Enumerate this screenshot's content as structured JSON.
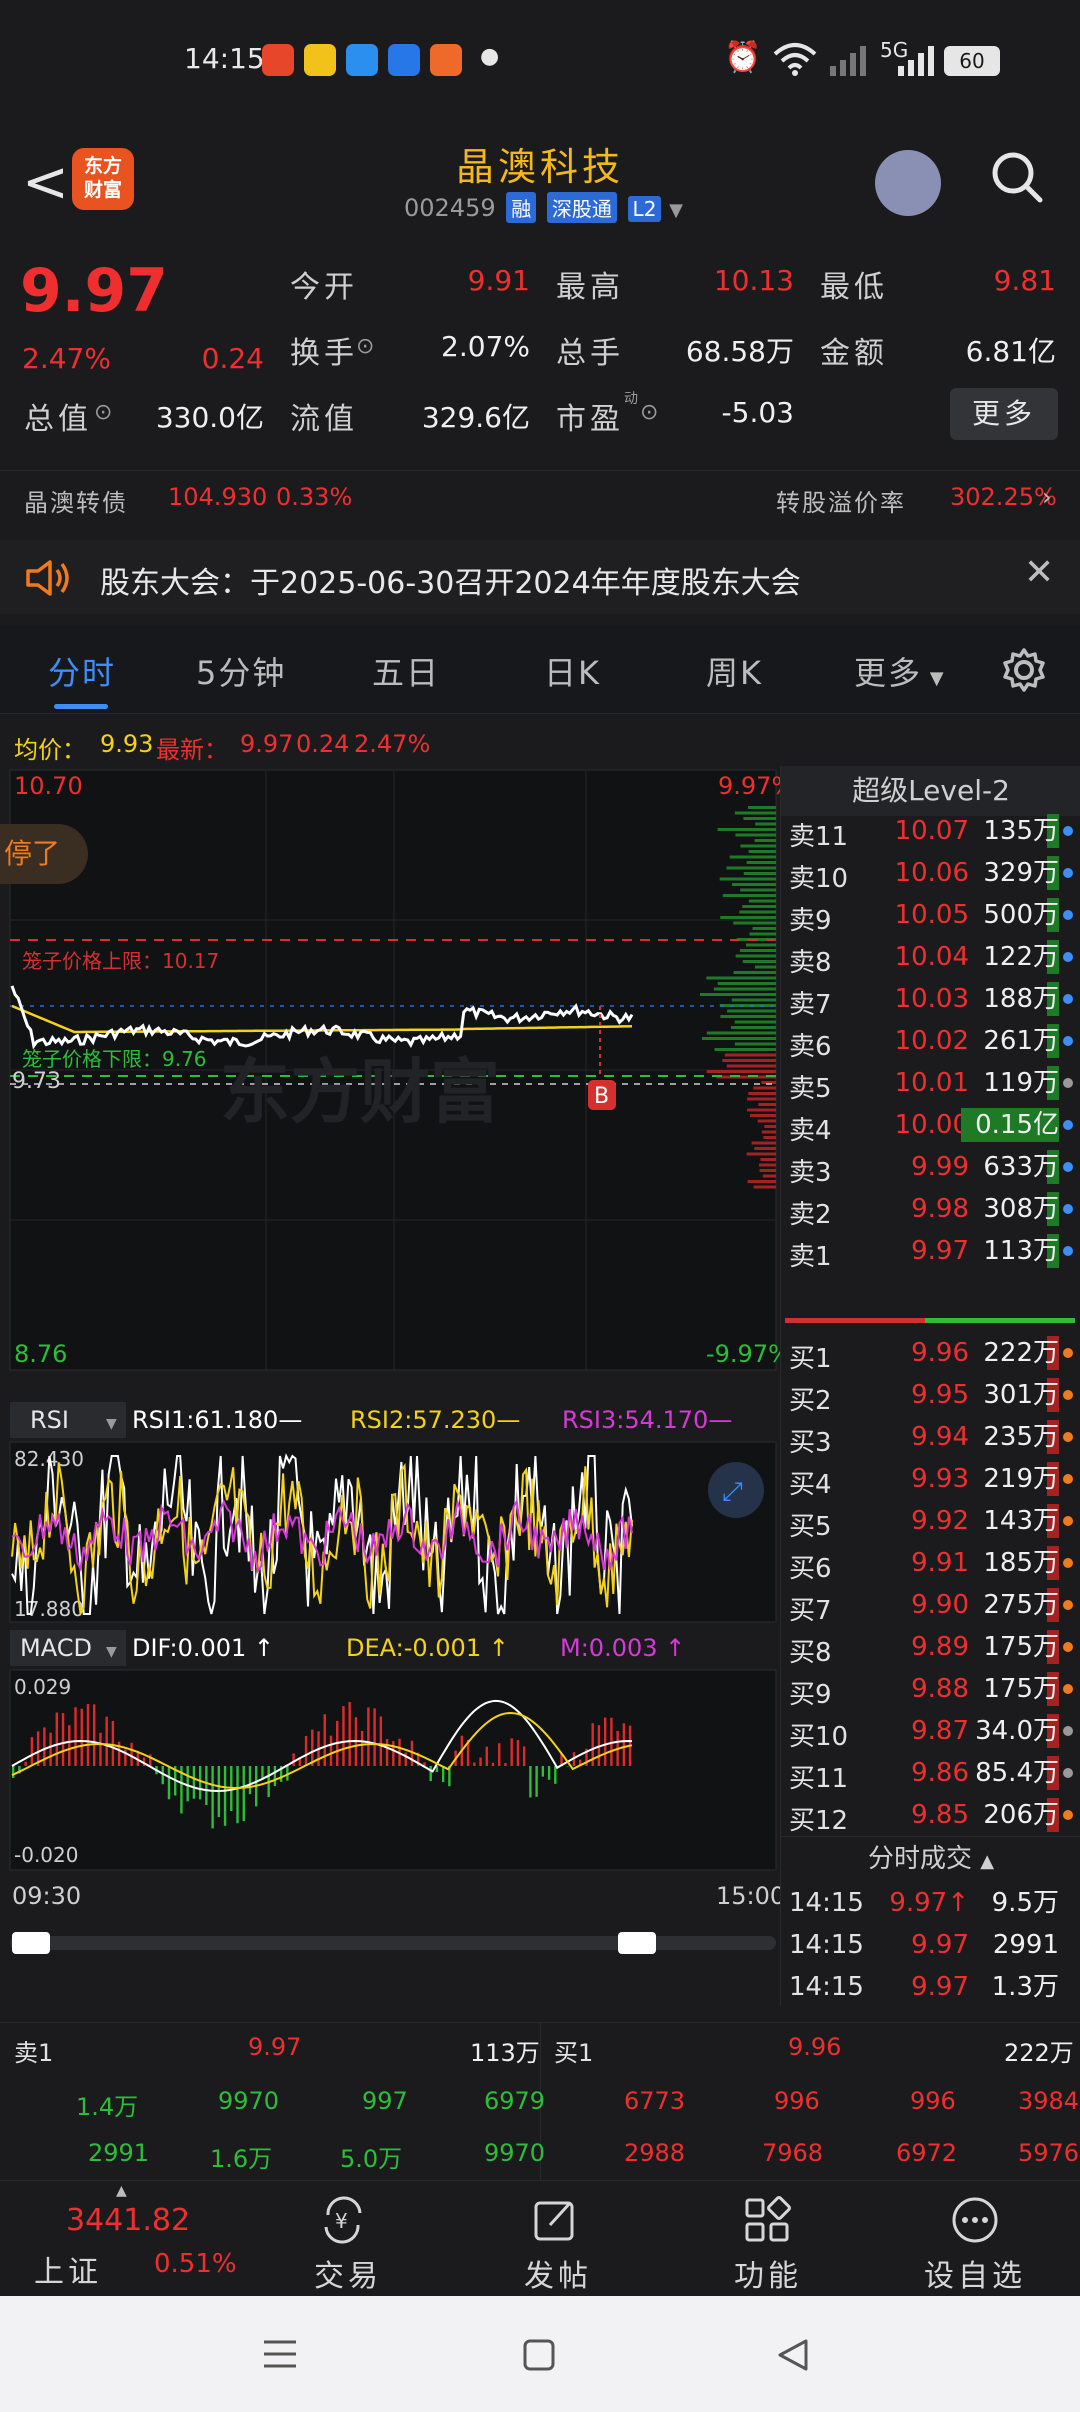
{
  "status": {
    "time": "14:15",
    "network": "5G",
    "battery": "60"
  },
  "header": {
    "back": "<",
    "logo_line1": "东方",
    "logo_line2": "财富",
    "stock_name": "晶澳科技",
    "code": "002459",
    "badges": [
      "融",
      "深股通",
      "L2"
    ]
  },
  "quote": {
    "price": "9.97",
    "change_pct": "2.47%",
    "change": "0.24",
    "open_label": "今开",
    "open": "9.91",
    "high_label": "最高",
    "high": "10.13",
    "low_label": "最低",
    "low": "9.81",
    "turnover_label": "换手",
    "turnover": "2.07%",
    "volume_label": "总手",
    "volume": "68.58万",
    "amount_label": "金额",
    "amount": "6.81亿",
    "mcap_label": "总值",
    "mcap": "330.0亿",
    "float_label": "流值",
    "float": "329.6亿",
    "pe_label": "市盈",
    "pe_sup": "动",
    "pe": "-5.03",
    "more": "更多"
  },
  "bond": {
    "name": "晶澳转债",
    "price": "104.930",
    "pct": "0.33%",
    "premium_label": "转股溢价率",
    "premium": "302.25%"
  },
  "notice": {
    "text": "股东大会：于2025-06-30召开2024年年度股东大会"
  },
  "tabs": [
    "分时",
    "5分钟",
    "五日",
    "日K",
    "周K",
    "更多"
  ],
  "avg": {
    "avg_label": "均价：",
    "avg": "9.93",
    "last_label": "最新：",
    "last": "9.97",
    "chg": "0.24",
    "pct": "2.47%"
  },
  "chart": {
    "top_price": "10.70",
    "top_pct": "9.97%",
    "bottom_price": "8.76",
    "bottom_pct": "-9.97%",
    "cage_upper": "笼子价格上限：10.17",
    "cage_lower": "笼子价格下限：9.76",
    "prev_close": "9.73",
    "marker": "B",
    "toast": "停了",
    "watermark": "东方财富",
    "time_start": "09:30",
    "time_end": "15:00"
  },
  "rsi": {
    "name": "RSI",
    "rsi1": "RSI1:61.180—",
    "rsi2": "RSI2:57.230—",
    "rsi3": "RSI3:54.170—",
    "max": "82.430",
    "min": "17.880"
  },
  "macd": {
    "name": "MACD",
    "dif": "DIF:0.001 ↑",
    "dea": "DEA:-0.001 ↑",
    "m": "M:0.003 ↑",
    "max": "0.029",
    "min": "-0.020"
  },
  "level2": {
    "title": "超级Level-2",
    "asks": [
      {
        "n": "卖11",
        "p": "10.07",
        "v": "135万",
        "dot": "#3d8ef7"
      },
      {
        "n": "卖10",
        "p": "10.06",
        "v": "329万",
        "dot": "#3d8ef7"
      },
      {
        "n": "卖9",
        "p": "10.05",
        "v": "500万",
        "dot": "#3d8ef7"
      },
      {
        "n": "卖8",
        "p": "10.04",
        "v": "122万",
        "dot": "#3d8ef7"
      },
      {
        "n": "卖7",
        "p": "10.03",
        "v": "188万",
        "dot": "#3d8ef7"
      },
      {
        "n": "卖6",
        "p": "10.02",
        "v": "261万",
        "dot": "#3d8ef7"
      },
      {
        "n": "卖5",
        "p": "10.01",
        "v": "119万",
        "dot": "#9a9a9a"
      },
      {
        "n": "卖4",
        "p": "10.00",
        "v": "0.15亿",
        "dot": "#3d8ef7"
      },
      {
        "n": "卖3",
        "p": "9.99",
        "v": "633万",
        "dot": "#3d8ef7"
      },
      {
        "n": "卖2",
        "p": "9.98",
        "v": "308万",
        "dot": "#3d8ef7"
      },
      {
        "n": "卖1",
        "p": "9.97",
        "v": "113万",
        "dot": "#3d8ef7"
      }
    ],
    "bids": [
      {
        "n": "买1",
        "p": "9.96",
        "v": "222万",
        "dot": "#f07b1d"
      },
      {
        "n": "买2",
        "p": "9.95",
        "v": "301万",
        "dot": "#f07b1d"
      },
      {
        "n": "买3",
        "p": "9.94",
        "v": "235万",
        "dot": "#f07b1d"
      },
      {
        "n": "买4",
        "p": "9.93",
        "v": "219万",
        "dot": "#f07b1d"
      },
      {
        "n": "买5",
        "p": "9.92",
        "v": "143万",
        "dot": "#f07b1d"
      },
      {
        "n": "买6",
        "p": "9.91",
        "v": "185万",
        "dot": "#f07b1d"
      },
      {
        "n": "买7",
        "p": "9.90",
        "v": "275万",
        "dot": "#f07b1d"
      },
      {
        "n": "买8",
        "p": "9.89",
        "v": "175万",
        "dot": "#f07b1d"
      },
      {
        "n": "买9",
        "p": "9.88",
        "v": "175万",
        "dot": "#f07b1d"
      },
      {
        "n": "买10",
        "p": "9.87",
        "v": "34.0万",
        "dot": "#9a9a9a"
      },
      {
        "n": "买11",
        "p": "9.86",
        "v": "85.4万",
        "dot": "#9a9a9a"
      },
      {
        "n": "买12",
        "p": "9.85",
        "v": "206万",
        "dot": "#f07b1d"
      }
    ],
    "trades_title": "分时成交",
    "trades": [
      {
        "t": "14:15",
        "p": "9.97↑",
        "v": "9.5万"
      },
      {
        "t": "14:15",
        "p": "9.97",
        "v": "2991"
      },
      {
        "t": "14:15",
        "p": "9.97",
        "v": "1.3万"
      }
    ]
  },
  "bottom_ob": {
    "sell_label": "卖1",
    "sell_price": "9.97",
    "sell_vol": "113万",
    "buy_label": "买1",
    "buy_price": "9.96",
    "buy_vol": "222万",
    "sell_row1": [
      "1.4万",
      "9970",
      "997",
      "6979"
    ],
    "sell_row2": [
      "2991",
      "1.6万",
      "5.0万",
      "9970"
    ],
    "buy_row1": [
      "6773",
      "996",
      "996",
      "3984"
    ],
    "buy_row2": [
      "2988",
      "7968",
      "6972",
      "5976"
    ]
  },
  "nav": {
    "index_price": "3441.82",
    "index_name": "上证",
    "index_pct": "0.51%",
    "items": [
      "交易",
      "发帖",
      "功能",
      "设自选"
    ]
  }
}
